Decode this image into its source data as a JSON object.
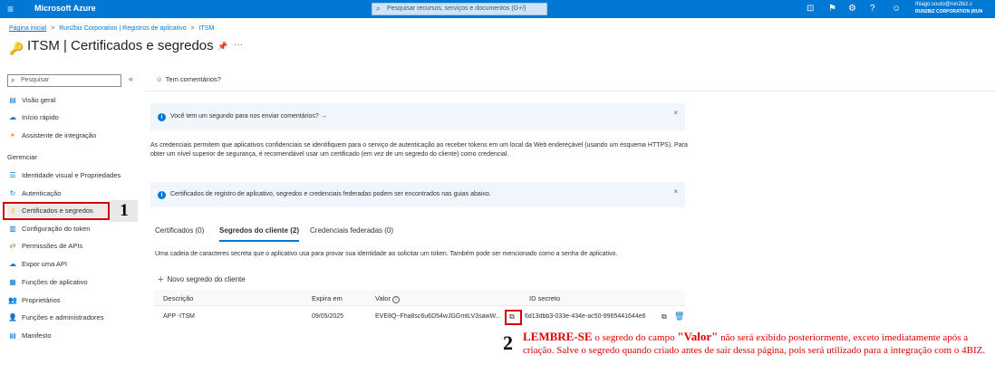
{
  "topbar": {
    "brand": "Microsoft Azure",
    "search_placeholder": "Pesquisar recursos, serviços e documentos (G+/)",
    "user_name": "thiago.souto@run2biz.c",
    "user_org": "RUN2BIZ CORPORATION (RUN",
    "icons": [
      "cloud-shell-icon",
      "directory-filter-icon",
      "settings-icon",
      "help-icon",
      "feedback-icon"
    ]
  },
  "breadcrumb": [
    "Página inicial",
    "Run2biz Corporation | Registros de aplicativo",
    "ITSM"
  ],
  "breadcrumb_sep": ">",
  "page": {
    "title": "ITSM | Certificados e segredos",
    "pin_icon": "pin-icon",
    "more": "···"
  },
  "sidebar": {
    "search_placeholder": "Pesquisar",
    "collapse": "«",
    "items_top": [
      {
        "label": "Visão geral",
        "icon": "overview-icon"
      },
      {
        "label": "Início rápido",
        "icon": "quickstart-icon"
      },
      {
        "label": "Assistente de integração",
        "icon": "integration-assistant-icon"
      }
    ],
    "section": "Gerenciar",
    "items_manage": [
      {
        "label": "Identidade visual e Propriedades",
        "icon": "branding-icon"
      },
      {
        "label": "Autenticação",
        "icon": "authentication-icon"
      },
      {
        "label": "Certificados e segredos",
        "icon": "key-icon"
      },
      {
        "label": "Configuração do token",
        "icon": "token-icon"
      },
      {
        "label": "Permissões de APIs",
        "icon": "api-permissions-icon"
      },
      {
        "label": "Expor uma API",
        "icon": "expose-api-icon"
      },
      {
        "label": "Funções de aplicativo",
        "icon": "app-roles-icon"
      },
      {
        "label": "Proprietários",
        "icon": "owners-icon"
      },
      {
        "label": "Funções e administradores",
        "icon": "roles-admins-icon"
      },
      {
        "label": "Manifesto",
        "icon": "manifest-icon"
      }
    ],
    "annotation_1": "1"
  },
  "main": {
    "feedback": "Tem comentários?",
    "info1": "Você tem um segundo para nos enviar comentários? →",
    "description": "As credenciais permitem que aplicativos confidenciais se identifiquem para o serviço de autenticação ao receber tokens em um local da Web endereçável (usando um esquema HTTPS). Para obter um nível superior de segurança, é recomendável usar um certificado (em vez de um segredo do cliente) como credencial.",
    "info2": "Certificados de registro de aplicativo, segredos e credenciais federadas podem ser encontrados nas guias abaixo.",
    "close": "×",
    "tabs": [
      "Certificados (0)",
      "Segredos do cliente (2)",
      "Credenciais federadas (0)"
    ],
    "active_tab": 1,
    "tab_description": "Uma cadeia de caracteres secreta que o aplicativo usa para provar sua identidade ao solicitar um token. Também pode ser mencionado como a senha de aplicativo.",
    "new_secret": "Novo segredo do cliente",
    "table": {
      "headers": [
        "Descrição",
        "Expira em",
        "Valor",
        "ID secreto"
      ],
      "rows": [
        {
          "description": "APP -ITSM",
          "expires": "09/05/2025",
          "value": "EVE8Q~Fha8sc6u6D54wJGGmtLV3sawW...",
          "secret_id": "6d13dbb3-033e-434e-ac50-9965441644e6"
        }
      ]
    }
  },
  "annotation": {
    "number": "2",
    "lead": "LEMBRE-SE",
    "text_a": " o segredo do campo ",
    "field": "\"Valor\"",
    "text_b": " não será exibido posteriormente, exceto imediatamente após a criação. Salve o segredo quando criado antes de sair dessa página, pois será utilizado para a integração com o 4BIZ."
  },
  "colors": {
    "azure_blue": "#0078d4",
    "annotation_red": "#e00000"
  }
}
